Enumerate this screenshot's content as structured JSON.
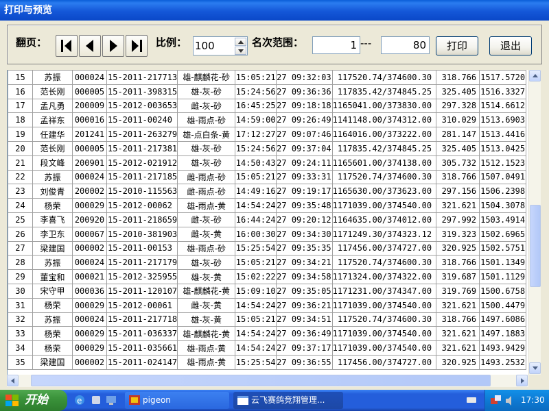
{
  "window": {
    "title": "打印与预览"
  },
  "toolbar": {
    "page_label": "翻页：",
    "ratio_label": "比例：",
    "ratio_value": "100",
    "range_label": "名次范围：",
    "range_from": "1",
    "range_sep": "---",
    "range_to": "80",
    "print_label": "打印",
    "exit_label": "退出"
  },
  "rows": [
    [
      "15",
      "苏振",
      "000024",
      "15-2011-217713",
      "雄-麒麟花-砂",
      "15:05:21",
      "27 09:32:03",
      "117520.74/374600.30",
      "318.766",
      "1517.5720"
    ],
    [
      "16",
      "范长刚",
      "000005",
      "15-2011-398315",
      "雄-灰-砂",
      "15:24:56",
      "27 09:36:36",
      "117835.42/374845.25",
      "325.405",
      "1516.3327"
    ],
    [
      "17",
      "孟凡勇",
      "200009",
      "15-2012-003653",
      "雌-灰-砂",
      "16:45:25",
      "27 09:18:18",
      "1165041.00/373830.00",
      "297.328",
      "1514.6612"
    ],
    [
      "18",
      "孟祥东",
      "000016",
      "15-2011-00240",
      "雄-雨点-砂",
      "14:59:00",
      "27 09:26:49",
      "1141148.00/374312.00",
      "310.029",
      "1513.6903"
    ],
    [
      "19",
      "任建华",
      "201241",
      "15-2011-263279",
      "雄-点白条-黄",
      "17:12:27",
      "27 09:07:46",
      "1164016.00/373222.00",
      "281.147",
      "1513.4416"
    ],
    [
      "20",
      "范长刚",
      "000005",
      "15-2011-217381",
      "雄-灰-砂",
      "15:24:56",
      "27 09:37:04",
      "117835.42/374845.25",
      "325.405",
      "1513.0425"
    ],
    [
      "21",
      "段文峰",
      "200901",
      "15-2012-021912",
      "雄-灰-砂",
      "14:50:43",
      "27 09:24:11",
      "1165601.00/374138.00",
      "305.732",
      "1512.1523"
    ],
    [
      "22",
      "苏振",
      "000024",
      "15-2011-217185",
      "雌-雨点-砂",
      "15:05:21",
      "27 09:33:31",
      "117520.74/374600.30",
      "318.766",
      "1507.0491"
    ],
    [
      "23",
      "刘俊青",
      "200002",
      "15-2010-115563",
      "雌-雨点-砂",
      "14:49:16",
      "27 09:19:17",
      "1165630.00/373623.00",
      "297.156",
      "1506.2398"
    ],
    [
      "24",
      "杨荣",
      "000029",
      "15-2012-00062",
      "雄-雨点-黄",
      "14:54:24",
      "27 09:35:48",
      "1171039.00/374540.00",
      "321.621",
      "1504.3078"
    ],
    [
      "25",
      "李喜飞",
      "200920",
      "15-2011-218659",
      "雌-灰-砂",
      "16:44:24",
      "27 09:20:12",
      "1164635.00/374012.00",
      "297.992",
      "1503.4914"
    ],
    [
      "26",
      "李卫东",
      "000067",
      "15-2010-381903",
      "雌-灰-黄",
      "16:00:30",
      "27 09:34:30",
      "1171249.30/374323.12",
      "319.323",
      "1502.6965"
    ],
    [
      "27",
      "梁建国",
      "000002",
      "15-2011-00153",
      "雄-雨点-砂",
      "15:25:54",
      "27 09:35:35",
      "117456.00/374727.00",
      "320.925",
      "1502.5751"
    ],
    [
      "28",
      "苏振",
      "000024",
      "15-2011-217179",
      "雄-灰-砂",
      "15:05:21",
      "27 09:34:21",
      "117520.74/374600.30",
      "318.766",
      "1501.1349"
    ],
    [
      "29",
      "董宝和",
      "000021",
      "15-2012-325955",
      "雄-灰-黄",
      "15:02:22",
      "27 09:34:58",
      "1171324.00/374322.00",
      "319.687",
      "1501.1129"
    ],
    [
      "30",
      "宋守甲",
      "000036",
      "15-2011-120107",
      "雄-麒麟花-黄",
      "15:09:10",
      "27 09:35:05",
      "1171231.00/374347.00",
      "319.769",
      "1500.6758"
    ],
    [
      "31",
      "杨荣",
      "000029",
      "15-2012-00061",
      "雌-灰-黄",
      "14:54:24",
      "27 09:36:21",
      "1171039.00/374540.00",
      "321.621",
      "1500.4479"
    ],
    [
      "32",
      "苏振",
      "000024",
      "15-2011-217718",
      "雄-灰-黄",
      "15:05:21",
      "27 09:34:51",
      "117520.74/374600.30",
      "318.766",
      "1497.6086"
    ],
    [
      "33",
      "杨荣",
      "000029",
      "15-2011-036337",
      "雄-麒麟花-黄",
      "14:54:24",
      "27 09:36:49",
      "1171039.00/374540.00",
      "321.621",
      "1497.1883"
    ],
    [
      "34",
      "杨荣",
      "000029",
      "15-2011-035661",
      "雄-雨点-黄",
      "14:54:24",
      "27 09:37:17",
      "1171039.00/374540.00",
      "321.621",
      "1493.9429"
    ],
    [
      "35",
      "梁建国",
      "000002",
      "15-2011-024147",
      "雄-雨点-黄",
      "15:25:54",
      "27 09:36:55",
      "117456.00/374727.00",
      "320.925",
      "1493.2532"
    ]
  ],
  "scrollbar": {
    "position_fraction": 0.62
  },
  "taskbar": {
    "start_label": "开始",
    "tasks": [
      "pigeon",
      "云飞赛鸽竞翔管理..."
    ],
    "clock": "17:30"
  },
  "icons": [
    "first-page-icon",
    "prev-page-icon",
    "next-page-icon",
    "last-page-icon",
    "windows-logo-icon",
    "ie-icon",
    "volume-icon",
    "clock-icon"
  ]
}
